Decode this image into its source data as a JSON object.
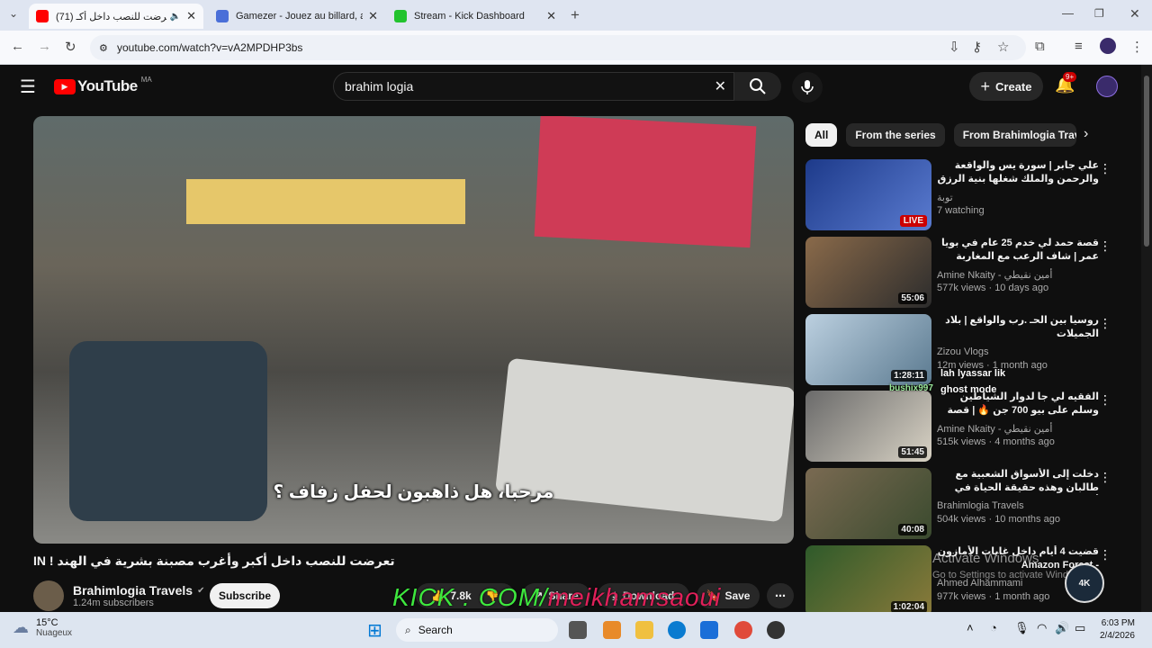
{
  "browser": {
    "tabs": [
      {
        "title": "(71) تعرضت للنصب داخل أكـ"
      },
      {
        "title": "Gamezer - Jouez au billard, au"
      },
      {
        "title": "Stream - Kick Dashboard"
      }
    ],
    "url": "youtube.com/watch?v=vA2MPDHP3bs"
  },
  "youtube": {
    "logo": "YouTube",
    "region": "MA",
    "search_query": "brahim logia",
    "create_label": "Create",
    "notif_badge": "9+"
  },
  "video": {
    "caption": "مرحبا، هل ذاهبون لحفل زفاف ؟",
    "title": "تعرضت للنصب داخل أكبر وأغرب مصبنة بشرية في الهند ! IN",
    "channel": "Brahimlogia Travels",
    "subscribers": "1.24m subscribers",
    "subscribe_label": "Subscribe",
    "likes": "7.8k",
    "share_label": "Share",
    "download_label": "Download",
    "save_label": "Save"
  },
  "chips": [
    "All",
    "From the series",
    "From Brahimlogia Travels"
  ],
  "recommendations": [
    {
      "title": "علي جابر | سورة يس والواقعة والرحمن والملك شغلها بنية الرزق وقضاء الدين وتفريج...",
      "channel": "توبة",
      "meta": "7 watching",
      "badge": "LIVE"
    },
    {
      "title": "قصة حمد لي خدم 25 عام في بويا عمر | شاف الرعب مع المغاربة",
      "channel": "Amine Nkaity - أمين نقيطي",
      "meta": "577k views · 10 days ago",
      "badge": "55:06"
    },
    {
      "title": "روسيا بين الحـ .رب والواقع | بلاد الجميلات",
      "channel": "Zizou Vlogs",
      "meta": "12m views · 1 month ago",
      "badge": "1:28:11"
    },
    {
      "title": "الفقيه لي جا لدوار الشياطين وسلم على بيو 700 جن 🔥 | قصة مغربية وقعات بامات ...",
      "channel": "Amine Nkaity - أمين نقيطي",
      "meta": "515k views · 4 months ago",
      "badge": "51:45"
    },
    {
      "title": "دخلت إلى الأسواق الشعبية مع طالبان وهذه حقيقة الحياة في أفغانستان AF",
      "channel": "Brahimlogia Travels",
      "meta": "504k views · 10 months ago",
      "badge": "40:08"
    },
    {
      "title": "قضيت 4 أيام داخل غابات الأمازون - Amazon Forest",
      "channel": "Ahmed Alhammami",
      "meta": "977k views · 1 month ago",
      "badge": "1:02:04"
    }
  ],
  "overlays": {
    "kick_prefix": "KICK . COM/",
    "kick_user": "meikhamsaoui",
    "stream1": "lah lyassar lik",
    "stream2": "ghost mode",
    "stream2_user": "bushix997",
    "activate_title": "Activate Windows",
    "activate_sub": "Go to Settings to activate Windows.",
    "logo": "4K"
  },
  "taskbar": {
    "temp": "15°C",
    "weather": "Nuageux",
    "search": "Search",
    "time": "6:03 PM",
    "date": "2/4/2026"
  }
}
